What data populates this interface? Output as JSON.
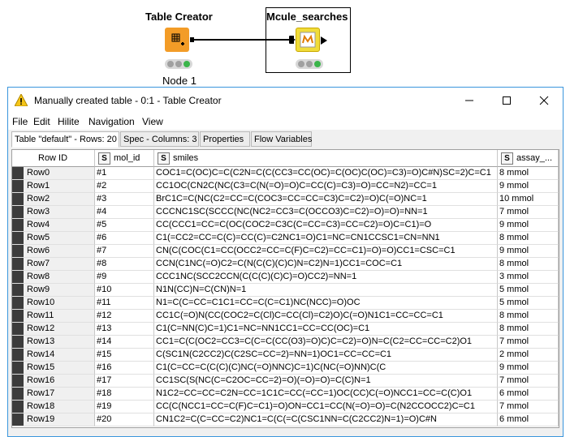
{
  "workflow": {
    "node1": {
      "title": "Table Creator",
      "label": "Node 1"
    },
    "node2": {
      "title": "Mcule_searches"
    }
  },
  "window": {
    "title": "Manually created table - 0:1 - Table Creator",
    "minimize": "—",
    "maximize": "☐",
    "close": "✕"
  },
  "menu": [
    "File",
    "Edit",
    "Hilite",
    "Navigation",
    "View"
  ],
  "tabs": [
    "Table \"default\" - Rows: 20",
    "Spec - Columns: 3",
    "Properties",
    "Flow Variables"
  ],
  "columns": {
    "rowid": "Row ID",
    "c1": {
      "type": "S",
      "name": "mol_id"
    },
    "c2": {
      "type": "S",
      "name": "smiles"
    },
    "c3": {
      "type": "S",
      "name": "assay_..."
    }
  },
  "rows": [
    {
      "id": "Row0",
      "mol": "#1",
      "smiles": "COC1=C(OC)C=C(C2N=C(C(CC3=CC(OC)=C(OC)C(OC)=C3)=O)C#N)SC=2)C=C1",
      "assay": "8 mmol"
    },
    {
      "id": "Row1",
      "mol": "#2",
      "smiles": "CC1OC(CN2C(NC(C3=C(N(=O)=O)C=CC(C)=C3)=O)=CC=N2)=CC=1",
      "assay": "9 mmol"
    },
    {
      "id": "Row2",
      "mol": "#3",
      "smiles": "BrC1C=C(NC(C2=CC=C(COC3=CC=CC=C3)C=C2)=O)C(=O)NC=1",
      "assay": "10 mmol"
    },
    {
      "id": "Row3",
      "mol": "#4",
      "smiles": "CCCNC1SC(SCCC(NC(NC2=CC3=C(OCCO3)C=C2)=O)=O)=NN=1",
      "assay": "7 mmol"
    },
    {
      "id": "Row4",
      "mol": "#5",
      "smiles": "CC(CCC1=CC=C(OC(COC2=C3C(C=CC=C3)=CC=C2)=O)C=C1)=O",
      "assay": "9 mmol"
    },
    {
      "id": "Row5",
      "mol": "#6",
      "smiles": "C1(=CC2=CC=C(C)=CC(C)=C2NC1=O)C1=NC=CN1CCSC1=CN=NN1",
      "assay": "8 mmol"
    },
    {
      "id": "Row6",
      "mol": "#7",
      "smiles": "CN(C(COC(C1=CC(OCC2=CC=C(F)C=C2)=CC=C1)=O)=O)CC1=CSC=C1",
      "assay": "9 mmol"
    },
    {
      "id": "Row7",
      "mol": "#8",
      "smiles": "CCN(C1NC(=O)C2=C(N(C(C)(C)C)N=C2)N=1)CC1=COC=C1",
      "assay": "8 mmol"
    },
    {
      "id": "Row8",
      "mol": "#9",
      "smiles": "CCC1NC(SCC2CCN(C(C(C)(C)C)=O)CC2)=NN=1",
      "assay": "3 mmol"
    },
    {
      "id": "Row9",
      "mol": "#10",
      "smiles": "N1N(CC)N=C(CN)N=1",
      "assay": "5 mmol"
    },
    {
      "id": "Row10",
      "mol": "#11",
      "smiles": "N1=C(C=CC=C1C1=CC=C(C=C1)NC(NCC)=O)OC",
      "assay": "5 mmol"
    },
    {
      "id": "Row11",
      "mol": "#12",
      "smiles": "CC1C(=O)N(CC(COC2=C(Cl)C=CC(Cl)=C2)O)C(=O)N1C1=CC=CC=C1",
      "assay": "8 mmol"
    },
    {
      "id": "Row12",
      "mol": "#13",
      "smiles": "C1(C=NN(C)C=1)C1=NC=NN1CC1=CC=CC(OC)=C1",
      "assay": "8 mmol"
    },
    {
      "id": "Row13",
      "mol": "#14",
      "smiles": "CC1=C(C(OC2=CC3=C(C=C(CC(O3)=O)C)C=C2)=O)N=C(C2=CC=CC=C2)O1",
      "assay": "7 mmol"
    },
    {
      "id": "Row14",
      "mol": "#15",
      "smiles": "C(SC1N(C2CC2)C(C2SC=CC=2)=NN=1)OC1=CC=CC=C1",
      "assay": "2 mmol"
    },
    {
      "id": "Row15",
      "mol": "#16",
      "smiles": "C1(C=CC=C(C(C)(C)NC(=O)NNC)C=1)C(NC(=O)NN)C(C",
      "assay": "9 mmol"
    },
    {
      "id": "Row16",
      "mol": "#17",
      "smiles": "CC1SC(S(NC(C=C2OC=CC=2)=O)(=O)=O)=C(C)N=1",
      "assay": "7 mmol"
    },
    {
      "id": "Row17",
      "mol": "#18",
      "smiles": "N1C2=CC=CC=C2N=CC=1C1C=CC(=CC=1)OC(CC)C(=O)NCC1=CC=C(C)O1",
      "assay": "6 mmol"
    },
    {
      "id": "Row18",
      "mol": "#19",
      "smiles": "CC(C(NCC1=CC=C(F)C=C1)=O)ON=CC1=CC(N(=O)=O)=C(N2CCOCC2)C=C1",
      "assay": "7 mmol"
    },
    {
      "id": "Row19",
      "mol": "#20",
      "smiles": "CN1C2=C(C=CC=C2)NC1=C(C(=C(CSC1NN=C(C2CC2)N=1)=O)C#N",
      "assay": "6 mmol"
    }
  ],
  "colors": {
    "accent": "#f39c27",
    "window_border": "#3a96dd",
    "green": "#3bb54a"
  }
}
